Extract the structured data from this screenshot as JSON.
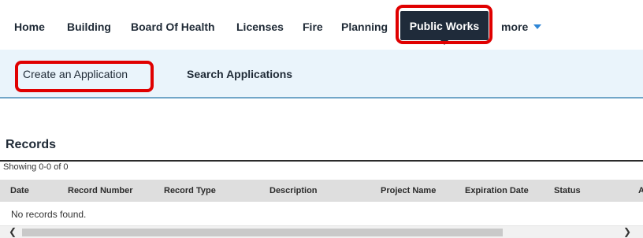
{
  "nav": {
    "items": [
      "Home",
      "Building",
      "Board Of Health",
      "Licenses",
      "Fire",
      "Planning"
    ],
    "active": "Public Works",
    "more": "more",
    "colors": {
      "active_bg": "#1f2b3a",
      "accent": "#2f86d6",
      "highlight": "#e00000"
    }
  },
  "subnav": {
    "create": "Create an Application",
    "search": "Search Applications"
  },
  "records": {
    "title": "Records",
    "showing": "Showing 0-0 of 0",
    "columns": [
      "Date",
      "Record Number",
      "Record Type",
      "Description",
      "Project Name",
      "Expiration Date",
      "Status",
      "A"
    ],
    "empty": "No records found."
  },
  "scrollbar": {
    "left_icon": "chevron-left-icon",
    "right_icon": "chevron-right-icon"
  }
}
